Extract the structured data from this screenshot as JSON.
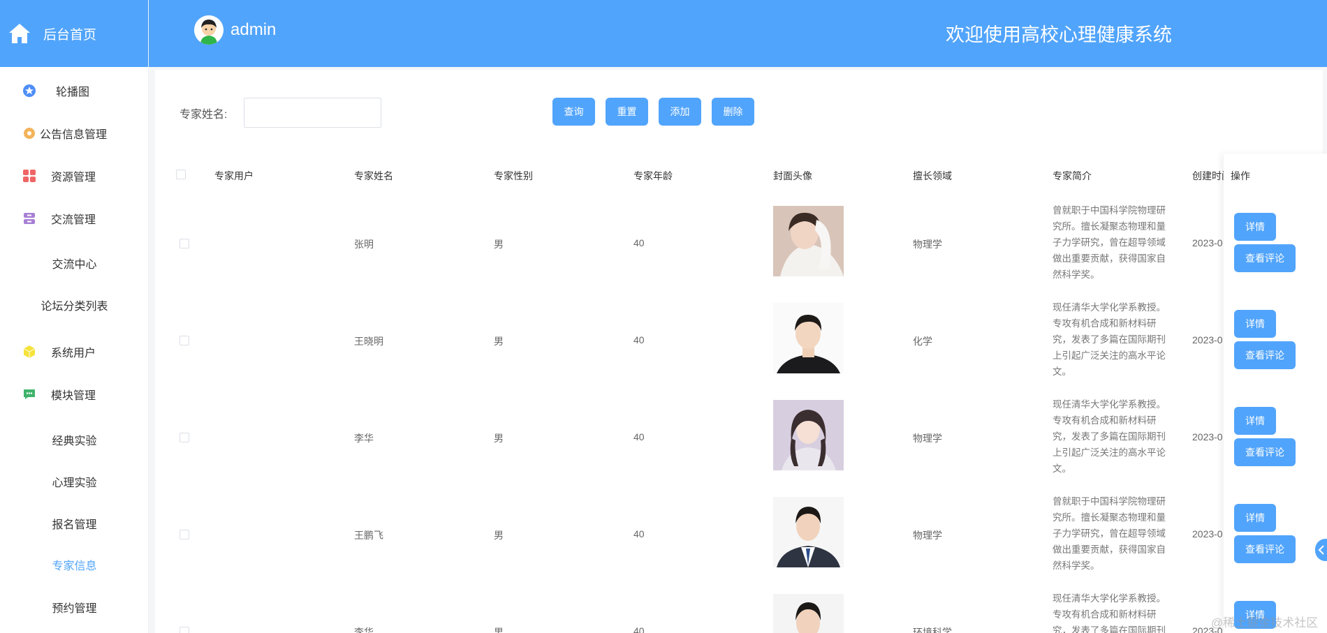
{
  "header": {
    "home_label": "后台首页",
    "username": "admin",
    "welcome": "欢迎使用高校心理健康系统"
  },
  "sidebar": {
    "items": [
      {
        "label": "轮播图",
        "icon": "star-icon"
      },
      {
        "label": "公告信息管理",
        "icon": "gear-icon"
      },
      {
        "label": "资源管理",
        "icon": "grid-icon"
      },
      {
        "label": "交流管理",
        "icon": "archive-icon"
      },
      {
        "label": "交流中心"
      },
      {
        "label": "论坛分类列表"
      },
      {
        "label": "系统用户",
        "icon": "cube-icon"
      },
      {
        "label": "模块管理",
        "icon": "chat-icon"
      },
      {
        "label": "经典实验"
      },
      {
        "label": "心理实验"
      },
      {
        "label": "报名管理"
      },
      {
        "label": "专家信息",
        "active": true
      },
      {
        "label": "预约管理"
      }
    ]
  },
  "search": {
    "label": "专家姓名:",
    "value": "",
    "buttons": {
      "query": "查询",
      "reset": "重置",
      "add": "添加",
      "delete": "删除"
    }
  },
  "table": {
    "columns": [
      "专家用户",
      "专家姓名",
      "专家性别",
      "专家年龄",
      "封面头像",
      "擅长领域",
      "专家简介",
      "创建时间",
      "操作"
    ],
    "rows": [
      {
        "user": "",
        "name": "张明",
        "gender": "男",
        "age": "40",
        "field": "物理学",
        "intro": "曾就职于中国科学院物理研究所。擅长凝聚态物理和量子力学研究，曾在超导领域做出重要贡献，获得国家自然科学奖。",
        "created": "2023-0"
      },
      {
        "user": "",
        "name": "王晓明",
        "gender": "男",
        "age": "40",
        "field": "化学",
        "intro": "现任清华大学化学系教授。专攻有机合成和新材料研究，发表了多篇在国际期刊上引起广泛关注的高水平论文。",
        "created": "2023-0"
      },
      {
        "user": "",
        "name": "李华",
        "gender": "男",
        "age": "40",
        "field": "物理学",
        "intro": "现任清华大学化学系教授。专攻有机合成和新材料研究，发表了多篇在国际期刊上引起广泛关注的高水平论文。",
        "created": "2023-0"
      },
      {
        "user": "",
        "name": "王鹏飞",
        "gender": "男",
        "age": "40",
        "field": "物理学",
        "intro": "曾就职于中国科学院物理研究所。擅长凝聚态物理和量子力学研究，曾在超导领域做出重要贡献，获得国家自然科学奖。",
        "created": "2023-0"
      },
      {
        "user": "",
        "name": "李华",
        "gender": "男",
        "age": "40",
        "field": "环境科学",
        "intro": "现任清华大学化学系教授。专攻有机合成和新材料研究，发表了多篇在国际期刊上引起广泛关注的高水平论文。",
        "created": "2023-0"
      }
    ],
    "op_detail": "详情",
    "op_comments": "查看评论"
  },
  "watermark": "@稀土掘金技术社区",
  "colors": {
    "accent": "#51a4fb"
  }
}
